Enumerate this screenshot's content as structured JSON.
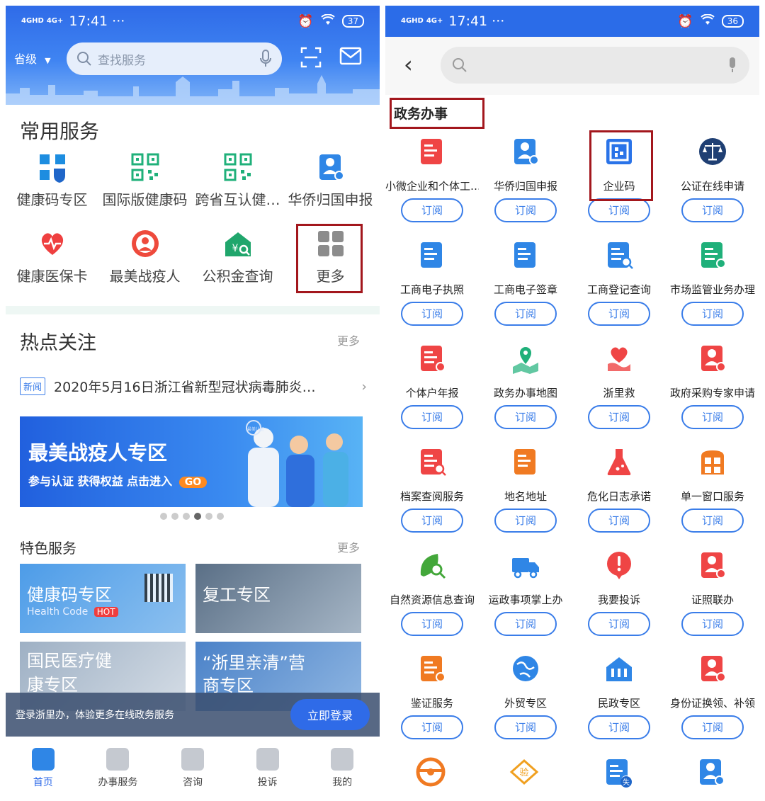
{
  "left": {
    "status": {
      "signal1": "4GHD",
      "signal2": "4G+",
      "time": "17:41",
      "dots": "···",
      "battery": "37"
    },
    "header": {
      "province": "省级",
      "search_placeholder": "查找服务"
    },
    "common": {
      "title": "常用服务",
      "items": [
        {
          "label": "健康码专区",
          "icon": "health-code-icon",
          "color": "#1d8de0"
        },
        {
          "label": "国际版健康码",
          "icon": "qr-code-icon",
          "color": "#1fb07a"
        },
        {
          "label": "跨省互认健…",
          "icon": "qr-code-icon",
          "color": "#1fb07a"
        },
        {
          "label": "华侨归国申报",
          "icon": "person-form-icon",
          "color": "#2f86e6"
        },
        {
          "label": "健康医保卡",
          "icon": "heart-pulse-icon",
          "color": "#ef4040"
        },
        {
          "label": "最美战疫人",
          "icon": "medical-staff-icon",
          "color": "#ee4a3c"
        },
        {
          "label": "公积金查询",
          "icon": "house-fund-icon",
          "color": "#20a66c"
        },
        {
          "label": "更多",
          "icon": "more-grid-icon",
          "color": "#8c8c8c"
        }
      ]
    },
    "hot": {
      "title": "热点关注",
      "more": "更多",
      "tag": "新闻",
      "headline": "2020年5月16日浙江省新型冠状病毒肺炎…"
    },
    "banner": {
      "title": "最美战疫人专区",
      "subtitle": "参与认证 获得权益 点击进入",
      "go": "GO",
      "badge": "最美认证"
    },
    "featured": {
      "title": "特色服务",
      "more": "更多",
      "cards": [
        {
          "title": "健康码专区",
          "subtitle": "Health Code",
          "badge": "HOT"
        },
        {
          "title": "复工专区",
          "subtitle": ""
        },
        {
          "title": "国民医疗健康专区",
          "subtitle": ""
        },
        {
          "title": "“浙里亲清”营商专区",
          "subtitle": ""
        }
      ]
    },
    "login": {
      "text": "登录浙里办，体验更多在线政务服务",
      "button": "立即登录"
    },
    "tabs": [
      {
        "label": "首页",
        "icon": "home-icon"
      },
      {
        "label": "办事服务",
        "icon": "document-icon"
      },
      {
        "label": "咨询",
        "icon": "chat-icon"
      },
      {
        "label": "投诉",
        "icon": "shield-icon"
      },
      {
        "label": "我的",
        "icon": "user-icon"
      }
    ]
  },
  "right": {
    "status": {
      "signal1": "4GHD",
      "signal2": "4G+",
      "time": "17:41",
      "dots": "···",
      "battery": "36"
    },
    "category": "政务办事",
    "subscribe_label": "订阅",
    "items": [
      {
        "label": "小微企业和个体工…",
        "icon": "certificate-icon",
        "color": "#ef4545"
      },
      {
        "label": "华侨归国申报",
        "icon": "person-form-icon",
        "color": "#2f86e6"
      },
      {
        "label": "企业码",
        "icon": "enterprise-code-icon",
        "color": "#2a73e8"
      },
      {
        "label": "公证在线申请",
        "icon": "scales-icon",
        "color": "#1f3f73"
      },
      {
        "label": "工商电子执照",
        "icon": "license-icon",
        "color": "#2f86e6"
      },
      {
        "label": "工商电子签章",
        "icon": "seal-icon",
        "color": "#2f86e6"
      },
      {
        "label": "工商登记查询",
        "icon": "search-record-icon",
        "color": "#2f86e6"
      },
      {
        "label": "市场监管业务办理",
        "icon": "chart-doc-icon",
        "color": "#1fb07a"
      },
      {
        "label": "个体户年报",
        "icon": "report-icon",
        "color": "#ef4545"
      },
      {
        "label": "政务办事地图",
        "icon": "map-pin-icon",
        "color": "#1fb07a"
      },
      {
        "label": "浙里救",
        "icon": "helping-heart-icon",
        "color": "#ef4545"
      },
      {
        "label": "政府采购专家申请",
        "icon": "expert-icon",
        "color": "#ef4545"
      },
      {
        "label": "档案查阅服务",
        "icon": "archive-icon",
        "color": "#ef4545"
      },
      {
        "label": "地名地址",
        "icon": "address-card-icon",
        "color": "#f07a22"
      },
      {
        "label": "危化日志承诺",
        "icon": "flask-icon",
        "color": "#ef4545"
      },
      {
        "label": "单一窗口服务",
        "icon": "window-icon",
        "color": "#f07a22"
      },
      {
        "label": "自然资源信息查询",
        "icon": "leaf-search-icon",
        "color": "#43a73a"
      },
      {
        "label": "运政事项掌上办",
        "icon": "truck-icon",
        "color": "#2f86e6"
      },
      {
        "label": "我要投诉",
        "icon": "alert-icon",
        "color": "#ef4545"
      },
      {
        "label": "证照联办",
        "icon": "id-card-icon",
        "color": "#ef4545"
      },
      {
        "label": "鉴证服务",
        "icon": "verify-doc-icon",
        "color": "#f07a22"
      },
      {
        "label": "外贸专区",
        "icon": "globe-icon",
        "color": "#2f86e6"
      },
      {
        "label": "民政专区",
        "icon": "civil-house-icon",
        "color": "#2f86e6"
      },
      {
        "label": "身份证换领、补领",
        "icon": "id-renew-icon",
        "color": "#ef4545"
      }
    ],
    "bottom_icons": [
      {
        "icon": "steering-wheel-icon",
        "color": "#f07a22"
      },
      {
        "icon": "inspection-icon",
        "color": "#f0a020",
        "text": "验"
      },
      {
        "icon": "lost-card-icon",
        "color": "#2f86e6",
        "text": "失"
      },
      {
        "icon": "person-id-icon",
        "color": "#2f86e6"
      }
    ]
  }
}
